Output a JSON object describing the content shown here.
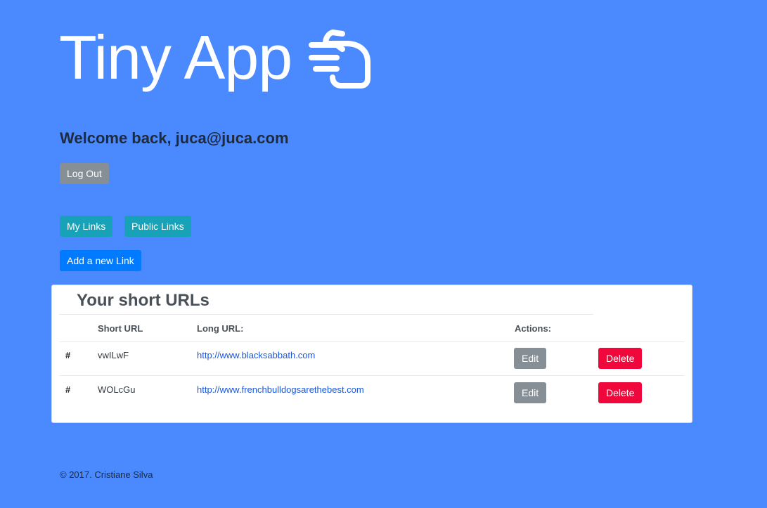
{
  "header": {
    "title": "Tiny App",
    "icon": "pointing-hand-icon"
  },
  "welcome": "Welcome back, juca@juca.com",
  "buttons": {
    "logout": "Log Out",
    "my_links": "My Links",
    "public_links": "Public Links",
    "add_link": "Add a new Link"
  },
  "table": {
    "title": "Your short URLs",
    "columns": [
      "Short URL",
      "Long URL:",
      "Actions:"
    ],
    "rows": [
      {
        "index": "#",
        "short": "vwILwF",
        "long": "http://www.blacksabbath.com",
        "edit": "Edit",
        "delete": "Delete"
      },
      {
        "index": "#",
        "short": "WOLcGu",
        "long": "http://www.frenchbulldogsarethebest.com",
        "edit": "Edit",
        "delete": "Delete"
      }
    ]
  },
  "footer": "© 2017. Cristiane Silva",
  "colors": {
    "background": "#4a89fe",
    "logout_button": "#868e96",
    "info_button": "#17a2b8",
    "primary_button": "#007bff",
    "delete_button": "#f0083c",
    "link": "#1a56db"
  }
}
